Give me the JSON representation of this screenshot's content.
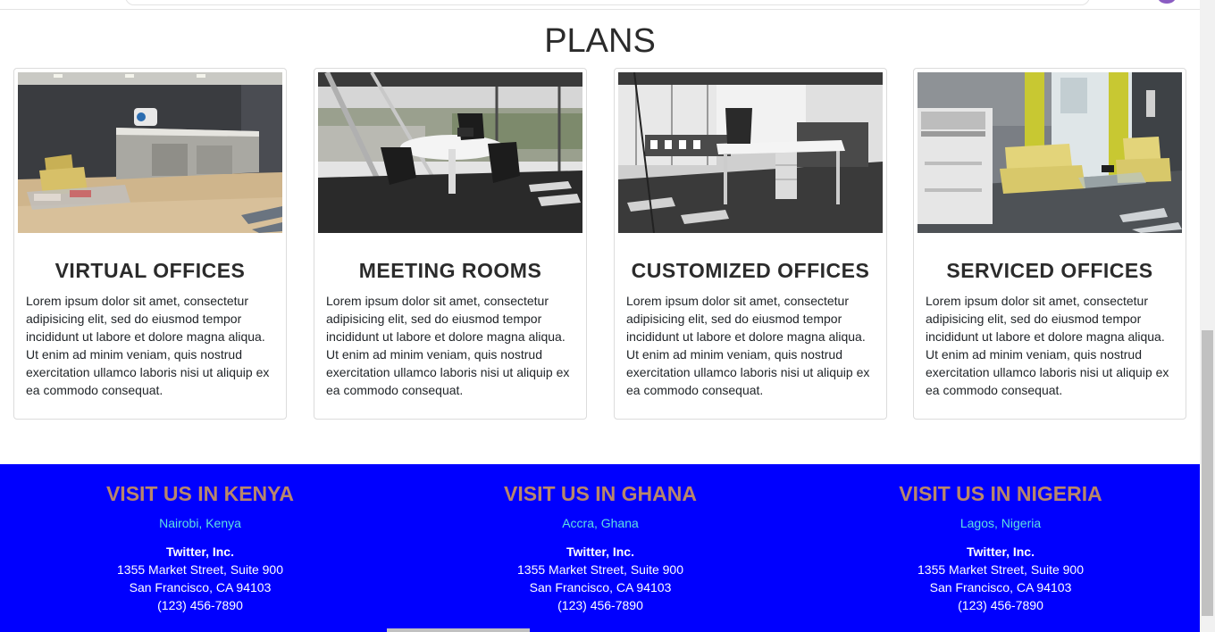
{
  "page": {
    "section_title": "PLANS"
  },
  "plans": [
    {
      "title": "VIRTUAL OFFICES",
      "text": "Lorem ipsum dolor sit amet, consectetur adipisicing elit, sed do eiusmod tempor incididunt ut labore et dolore magna aliqua. Ut enim ad minim veniam, quis nostrud exercitation ullamco laboris nisi ut aliquip ex ea commodo consequat."
    },
    {
      "title": "MEETING ROOMS",
      "text": "Lorem ipsum dolor sit amet, consectetur adipisicing elit, sed do eiusmod tempor incididunt ut labore et dolore magna aliqua. Ut enim ad minim veniam, quis nostrud exercitation ullamco laboris nisi ut aliquip ex ea commodo consequat."
    },
    {
      "title": "CUSTOMIZED OFFICES",
      "text": "Lorem ipsum dolor sit amet, consectetur adipisicing elit, sed do eiusmod tempor incididunt ut labore et dolore magna aliqua. Ut enim ad minim veniam, quis nostrud exercitation ullamco laboris nisi ut aliquip ex ea commodo consequat."
    },
    {
      "title": "SERVICED OFFICES",
      "text": "Lorem ipsum dolor sit amet, consectetur adipisicing elit, sed do eiusmod tempor incididunt ut labore et dolore magna aliqua. Ut enim ad minim veniam, quis nostrud exercitation ullamco laboris nisi ut aliquip ex ea commodo consequat."
    }
  ],
  "footer": {
    "columns": [
      {
        "title": "VISIT US IN KENYA",
        "city": "Nairobi, Kenya",
        "company": "Twitter, Inc.",
        "street": "1355 Market Street, Suite 900",
        "locality": "San Francisco, CA 94103",
        "phone": "(123) 456-7890"
      },
      {
        "title": "VISIT US IN GHANA",
        "city": "Accra, Ghana",
        "company": "Twitter, Inc.",
        "street": "1355 Market Street, Suite 900",
        "locality": "San Francisco, CA 94103",
        "phone": "(123) 456-7890"
      },
      {
        "title": "VISIT US IN NIGERIA",
        "city": "Lagos, Nigeria",
        "company": "Twitter, Inc.",
        "street": "1355 Market Street, Suite 900",
        "locality": "San Francisco, CA 94103",
        "phone": "(123) 456-7890"
      }
    ]
  },
  "colors": {
    "footer_bg": "#0000ff",
    "footer_title": "#b8866b",
    "footer_city": "#5fe0e0"
  }
}
